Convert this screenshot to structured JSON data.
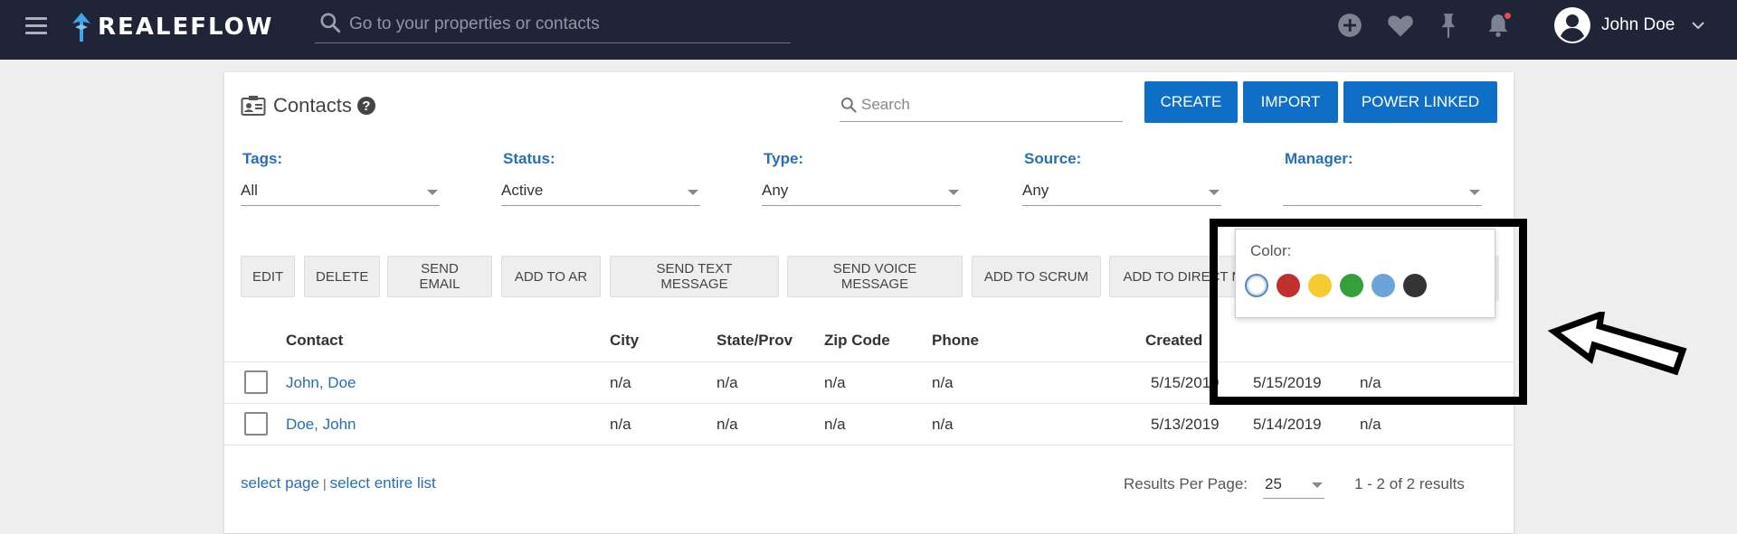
{
  "app": {
    "logo_text": "REALEFLOW"
  },
  "topbar": {
    "search_placeholder": "Go to your properties or contacts",
    "icons": [
      "menu-icon",
      "add-circle-icon",
      "heart-icon",
      "pin-icon",
      "bell-icon",
      "account-circle-icon",
      "chevron-down-icon"
    ],
    "user_name": "John Doe"
  },
  "page": {
    "title": "Contacts",
    "help_glyph": "?",
    "search_placeholder": "Search",
    "buttons": {
      "create": "CREATE",
      "import": "IMPORT",
      "power_linked": "POWER LINKED"
    }
  },
  "filters": [
    {
      "label": "Tags:",
      "value": "All"
    },
    {
      "label": "Status:",
      "value": "Active"
    },
    {
      "label": "Type:",
      "value": "Any"
    },
    {
      "label": "Source:",
      "value": "Any"
    },
    {
      "label": "Manager:",
      "value": ""
    }
  ],
  "actions": [
    "EDIT",
    "DELETE",
    "SEND EMAIL",
    "ADD TO AR",
    "SEND TEXT MESSAGE",
    "SEND VOICE MESSAGE",
    "ADD TO SCRUM",
    "ADD TO DIRECT MAIL"
  ],
  "toolbar_icons": [
    "comment-icon",
    "filter-icon",
    "star-icon",
    "eyedropper-icon"
  ],
  "table": {
    "columns": [
      "Contact",
      "City",
      "State/Prov",
      "Zip Code",
      "Phone",
      "Created"
    ],
    "rows": [
      {
        "contact": "John, Doe",
        "city": "n/a",
        "state": "n/a",
        "zip": "n/a",
        "phone": "n/a",
        "created": "5/15/2019",
        "col7": "5/15/2019",
        "col8": "n/a"
      },
      {
        "contact": "Doe, John",
        "city": "n/a",
        "state": "n/a",
        "zip": "n/a",
        "phone": "n/a",
        "created": "5/13/2019",
        "col7": "5/14/2019",
        "col8": "n/a"
      }
    ]
  },
  "footer": {
    "select_page": "select page",
    "separator": "|",
    "select_list": "select entire list",
    "results_per_page_label": "Results Per Page:",
    "results_per_page": "25",
    "range": "1 - 2 of 2 results"
  },
  "color_popover": {
    "label": "Color:",
    "swatches": [
      "#ffffff",
      "#c0302d",
      "#f4cc2f",
      "#33a03a",
      "#6aa4d8",
      "#333333"
    ]
  }
}
